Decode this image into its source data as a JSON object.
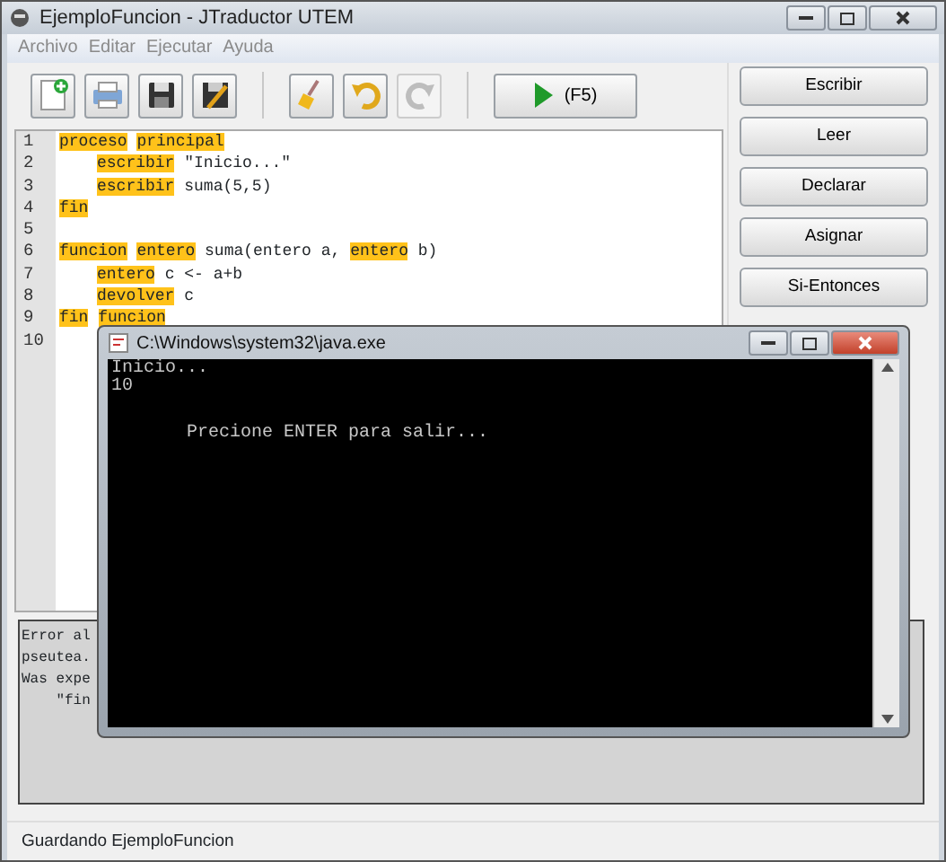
{
  "window": {
    "title": "EjemploFuncion - JTraductor UTEM"
  },
  "menu": [
    "Archivo",
    "Editar",
    "Ejecutar",
    "Ayuda"
  ],
  "toolbar": [
    {
      "kind": "new",
      "disabled": false
    },
    {
      "kind": "print",
      "disabled": false
    },
    {
      "kind": "save",
      "disabled": false
    },
    {
      "kind": "save-as",
      "disabled": false
    },
    {
      "kind": "clean",
      "disabled": false
    },
    {
      "kind": "undo",
      "disabled": false
    },
    {
      "kind": "redo",
      "disabled": true
    }
  ],
  "run_button": {
    "label": "(F5)"
  },
  "editor": {
    "lines": [
      {
        "number": "1",
        "indented": false,
        "tokens": [
          {
            "text": "proceso",
            "keyword": true
          },
          {
            "text": "principal",
            "keyword": true
          }
        ]
      },
      {
        "number": "2",
        "indented": true,
        "tokens": [
          {
            "text": "escribir",
            "keyword": true
          },
          {
            "text": "\"Inicio...\"",
            "keyword": false
          }
        ]
      },
      {
        "number": "3",
        "indented": true,
        "tokens": [
          {
            "text": "escribir",
            "keyword": true
          },
          {
            "text": "suma(5,5)",
            "keyword": false
          }
        ]
      },
      {
        "number": "4",
        "indented": false,
        "tokens": [
          {
            "text": "fin",
            "keyword": true
          }
        ]
      },
      {
        "number": "5"
      },
      {
        "number": "6",
        "indented": false,
        "tokens": [
          {
            "text": "funcion",
            "keyword": true
          },
          {
            "text": "entero",
            "keyword": true
          },
          {
            "text": "suma(entero a,",
            "keyword": false
          },
          {
            "text": "entero",
            "keyword": true
          },
          {
            "text": "b)",
            "keyword": false
          }
        ]
      },
      {
        "number": "7",
        "indented": true,
        "tokens": [
          {
            "text": "entero",
            "keyword": true
          },
          {
            "text": "c <- a+b",
            "keyword": false
          }
        ]
      },
      {
        "number": "8",
        "indented": true,
        "tokens": [
          {
            "text": "devolver",
            "keyword": true
          },
          {
            "text": "c",
            "keyword": false
          }
        ]
      },
      {
        "number": "9",
        "indented": false,
        "tokens": [
          {
            "text": "fin",
            "keyword": true
          },
          {
            "text": "funcion",
            "keyword": true
          }
        ]
      },
      {
        "number": "10"
      }
    ]
  },
  "side_buttons": [
    "Escribir",
    "Leer",
    "Declarar",
    "Asignar",
    "Si-Entonces"
  ],
  "error_output": {
    "lines": [
      "Error al",
      "pseutea.",
      "Was expe",
      "    \"fin"
    ]
  },
  "status_bar": "Guardando EjemploFuncion",
  "console": {
    "title": "C:\\Windows\\system32\\java.exe",
    "output": [
      "Inicio...",
      "10"
    ],
    "prompt": "Precione ENTER para salir..."
  }
}
